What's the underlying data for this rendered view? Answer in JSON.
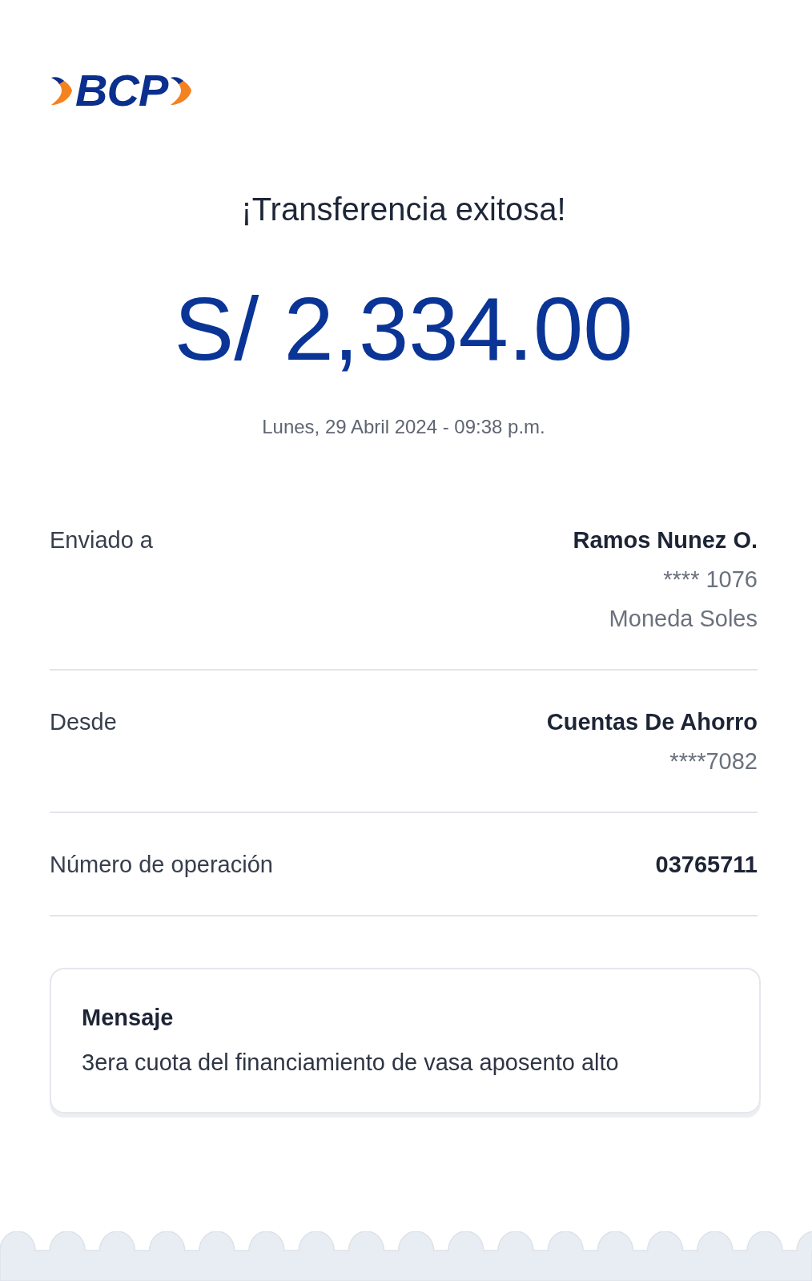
{
  "logo": {
    "text": "BCP"
  },
  "title": "¡Transferencia exitosa!",
  "amount": "S/ 2,334.00",
  "date": "Lunes, 29 Abril 2024 - 09:38 p.m.",
  "details": [
    {
      "label": "Enviado a",
      "values": [
        {
          "text": "Ramos Nunez O.",
          "kind": "primary"
        },
        {
          "text": "**** 1076",
          "kind": "secondary"
        },
        {
          "text": "Moneda Soles",
          "kind": "secondary"
        }
      ]
    },
    {
      "label": "Desde",
      "values": [
        {
          "text": "Cuentas De Ahorro",
          "kind": "primary"
        },
        {
          "text": "****7082",
          "kind": "secondary"
        }
      ]
    },
    {
      "label": "Número de operación",
      "values": [
        {
          "text": "03765711",
          "kind": "primary"
        }
      ]
    }
  ],
  "message": {
    "heading": "Mensaje",
    "text": "3era cuota del financiamiento de vasa aposento alto"
  }
}
